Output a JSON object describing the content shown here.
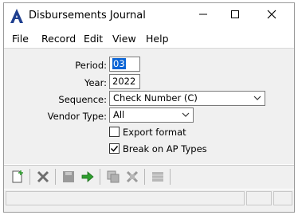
{
  "window": {
    "title": "Disbursements Journal"
  },
  "menu": [
    "File",
    "Record",
    "Edit",
    "View",
    "Help"
  ],
  "form": {
    "period_label": "Period:",
    "period_value": "03",
    "year_label": "Year:",
    "year_value": "2022",
    "sequence_label": "Sequence:",
    "sequence_value": "Check Number (C)",
    "vendor_type_label": "Vendor Type:",
    "vendor_type_value": "All",
    "export_format_label": "Export format",
    "export_format_checked": false,
    "break_label": "Break on AP Types",
    "break_checked": true
  },
  "toolbar": [
    "new-record-icon",
    "delete-icon",
    "save-icon",
    "go-arrow-icon",
    "copy-icon",
    "cut-icon",
    "list-icon"
  ],
  "colors": {
    "accent": "#0a64d6",
    "go_arrow": "#2e9e2e",
    "logo": "#1f3f8f"
  }
}
